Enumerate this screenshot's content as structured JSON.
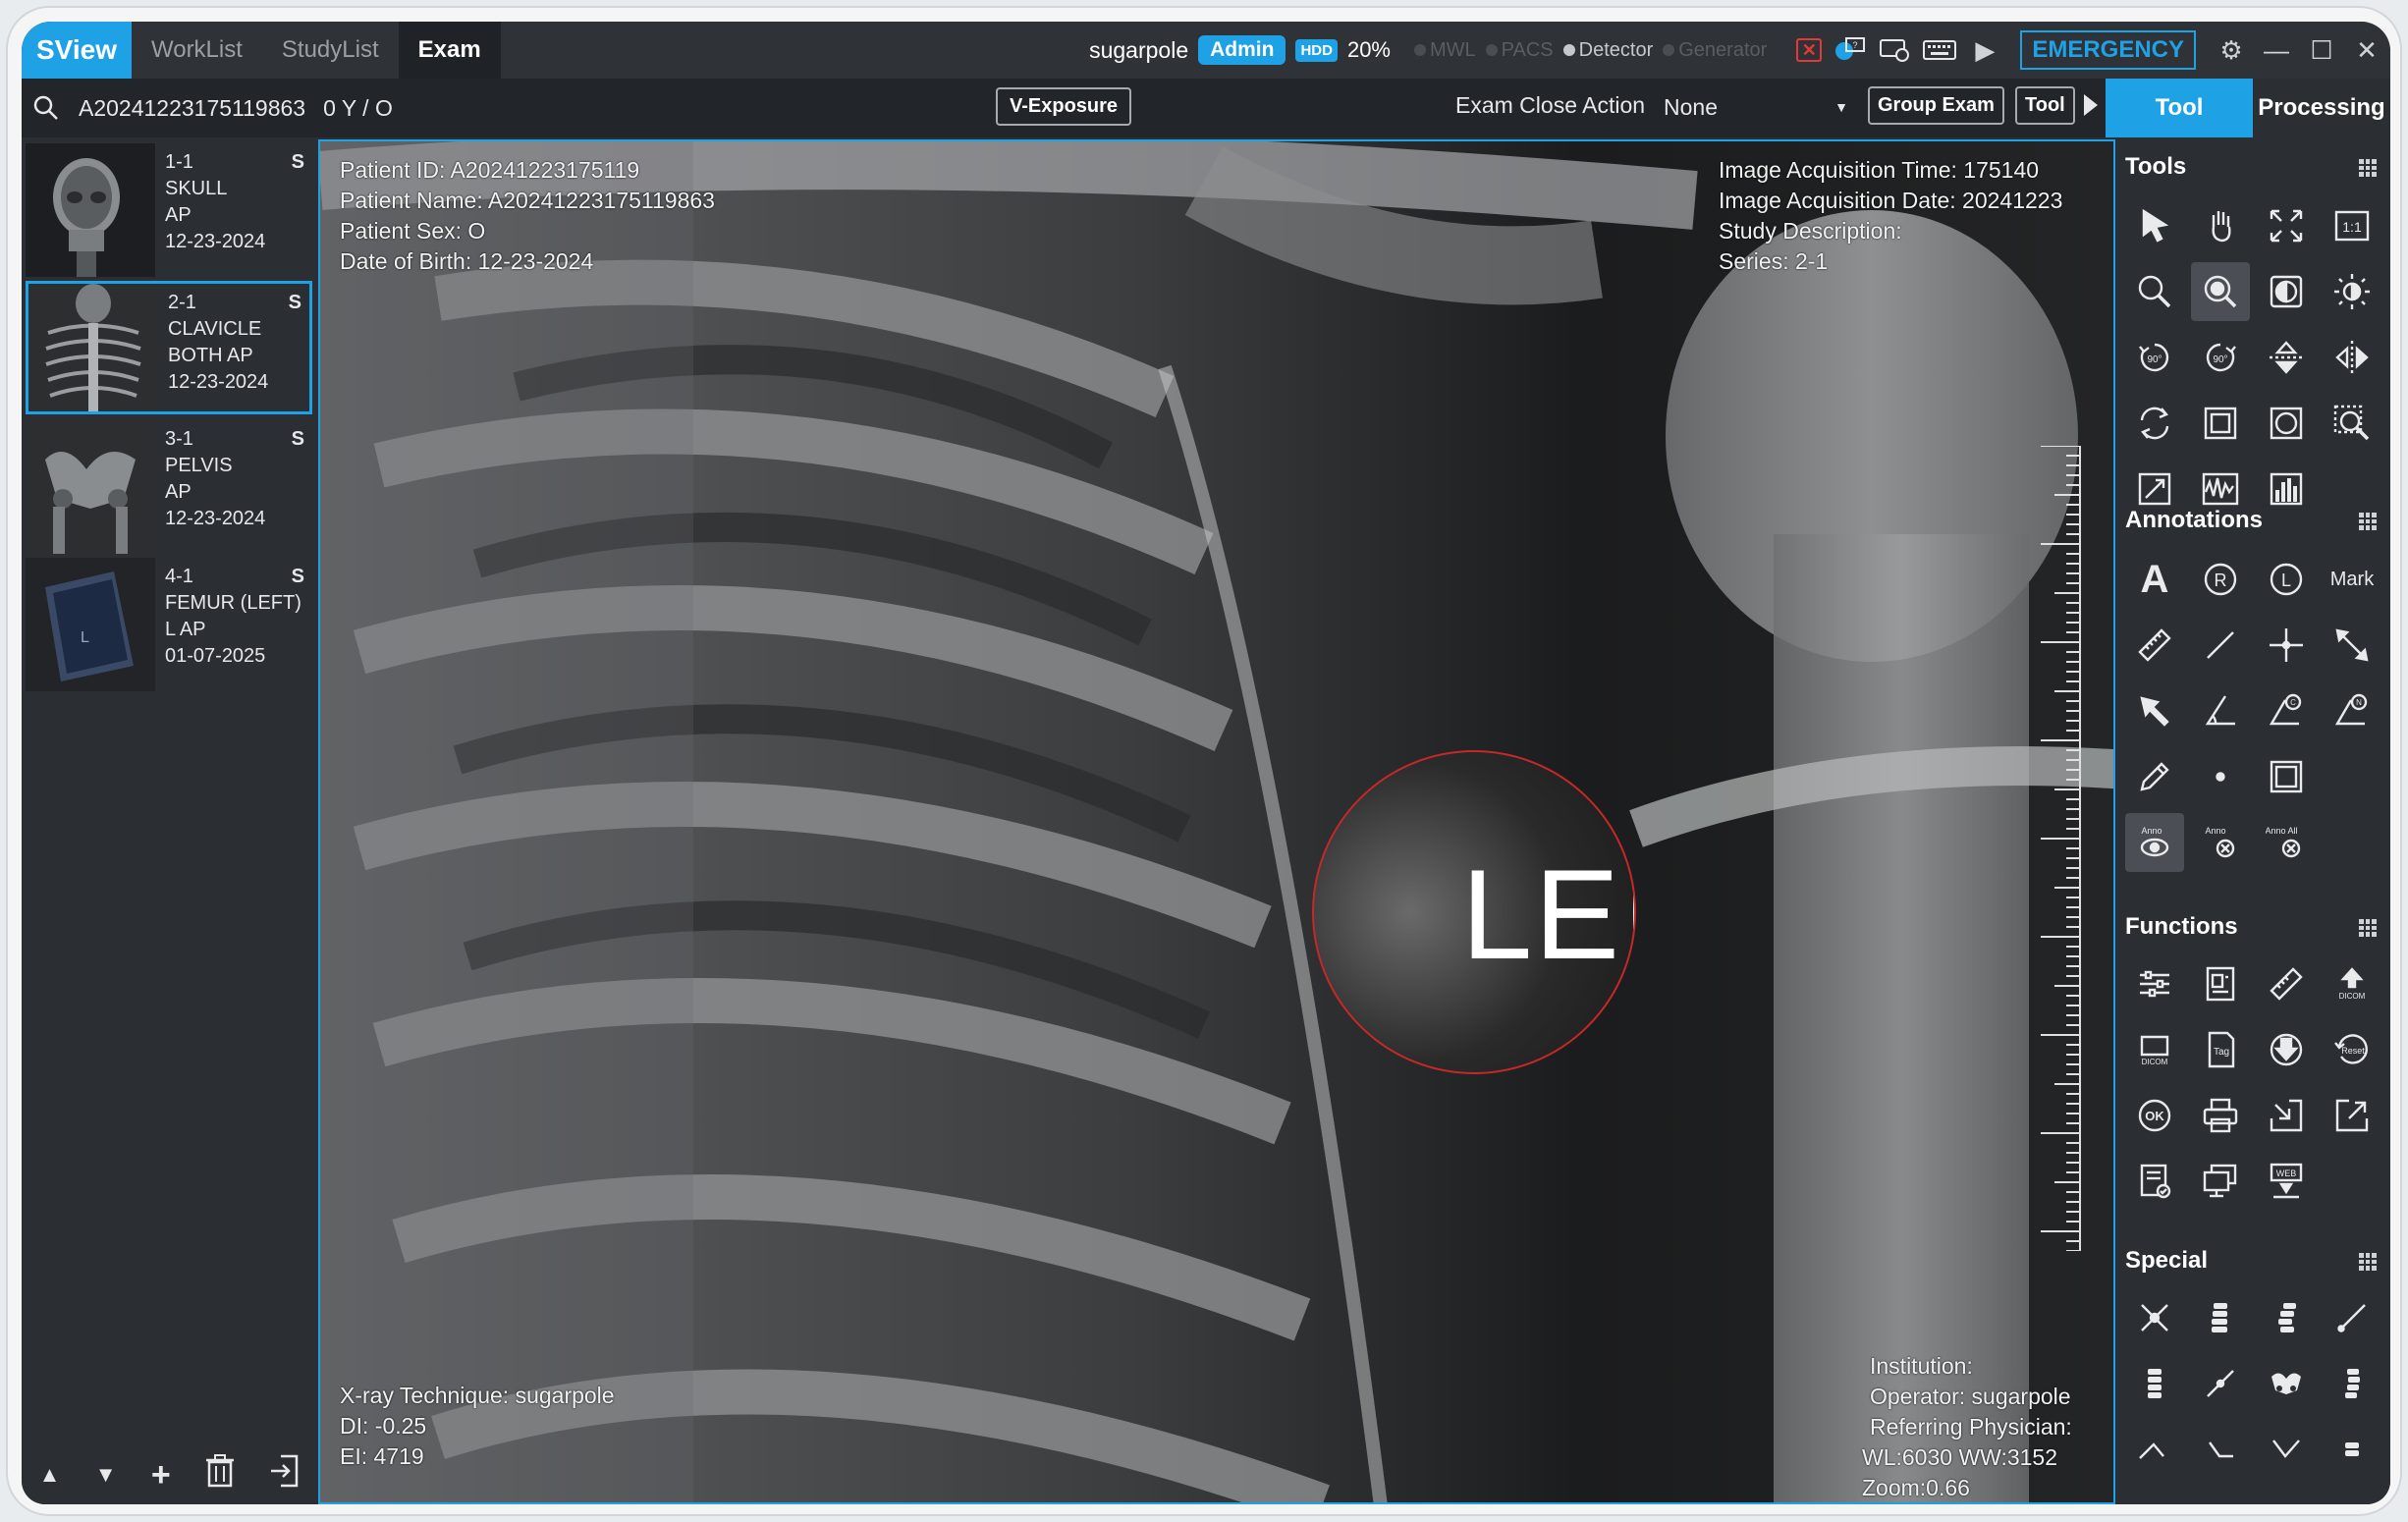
{
  "app": {
    "brand": "SView",
    "nav_tabs": [
      {
        "label": "WorkList",
        "active": false
      },
      {
        "label": "StudyList",
        "active": false
      },
      {
        "label": "Exam",
        "active": true
      }
    ],
    "user": "sugarpole",
    "role_badge": "Admin",
    "hdd_label": "HDD",
    "hdd_value": "20%",
    "statuses": [
      {
        "label": "MWL",
        "on": false
      },
      {
        "label": "PACS",
        "on": false
      },
      {
        "label": "Detector",
        "on": true
      },
      {
        "label": "Generator",
        "on": false
      }
    ],
    "emergency_label": "EMERGENCY",
    "accent_color": "#1fa1e6"
  },
  "toolbar": {
    "patient_accession": "A20241223175119863",
    "age_sex": "0 Y / O",
    "v_exposure_label": "V-Exposure",
    "exam_close_action_label": "Exam Close Action",
    "exam_close_action_value": "None",
    "group_exam_label": "Group Exam",
    "tool_label": "Tool",
    "tabs": [
      {
        "label": "Tool",
        "active": true
      },
      {
        "label": "Processing",
        "active": false
      }
    ]
  },
  "thumbnails": [
    {
      "index": "1-1",
      "body_part": "SKULL",
      "view": "AP",
      "date": "12-23-2024",
      "flag": "S",
      "selected": false
    },
    {
      "index": "2-1",
      "body_part": "CLAVICLE",
      "view": "BOTH AP",
      "date": "12-23-2024",
      "flag": "S",
      "selected": true
    },
    {
      "index": "3-1",
      "body_part": "PELVIS",
      "view": "AP",
      "date": "12-23-2024",
      "flag": "S",
      "selected": false
    },
    {
      "index": "4-1",
      "body_part": "FEMUR (LEFT)",
      "view": "L AP",
      "date": "01-07-2025",
      "flag": "S",
      "selected": false
    }
  ],
  "viewer": {
    "top_left": [
      "Patient ID: A20241223175119",
      "Patient Name: A20241223175119863",
      "Patient Sex: O",
      "Date of Birth: 12-23-2024"
    ],
    "top_right": [
      "Image Acquisition Time: 175140",
      "Image Acquisition Date: 20241223",
      "Study Description:",
      "Series: 2-1"
    ],
    "bottom_left": [
      "X-ray Technique: sugarpole",
      "DI: -0.25",
      "EI: 4719"
    ],
    "bottom_right": [
      "Institution:",
      "Operator: sugarpole",
      "Referring Physician:",
      "WL:6030 WW:3152",
      "Zoom:0.66"
    ],
    "lens_text": "LEI"
  },
  "panel": {
    "sections": [
      {
        "title": "Tools",
        "items": [
          "select-arrow",
          "pan-hand",
          "fit-window",
          "actual-size-1to1",
          "zoom",
          "magnifier",
          "invert",
          "brightness",
          "rotate-left-90",
          "rotate-right-90",
          "flip-vertical",
          "flip-horizontal",
          "reset-rotation",
          "rect-roi",
          "ellipse-roi",
          "zoom-region",
          "calibrate",
          "profile",
          "histogram"
        ]
      },
      {
        "title": "Annotations",
        "items": [
          "text-A",
          "marker-R",
          "marker-L",
          "Mark",
          "ruler",
          "line",
          "crosshair",
          "arrow-line",
          "arrow",
          "angle",
          "cobb-angle",
          "ct-ratio",
          "pencil",
          "dot",
          "rectangle",
          "anno-show",
          "anno-delete",
          "anno-delete-all"
        ]
      },
      {
        "title": "Functions",
        "items": [
          "settings-sliders",
          "report",
          "ruler-cal",
          "dicom-send",
          "dicom-save",
          "tag",
          "download",
          "reset",
          "ok",
          "print",
          "export",
          "share",
          "checklist",
          "monitor",
          "web-download"
        ]
      },
      {
        "title": "Special",
        "items": [
          "stitch-cross",
          "spine-1",
          "spine-2",
          "needle",
          "spine-3",
          "line-measure",
          "pelvis",
          "spine-4"
        ]
      }
    ],
    "anno_labels": {
      "show": "Anno",
      "delete": "Anno",
      "delete_all": "Anno All"
    },
    "mark_label": "Mark",
    "one_to_one": "1:1"
  }
}
